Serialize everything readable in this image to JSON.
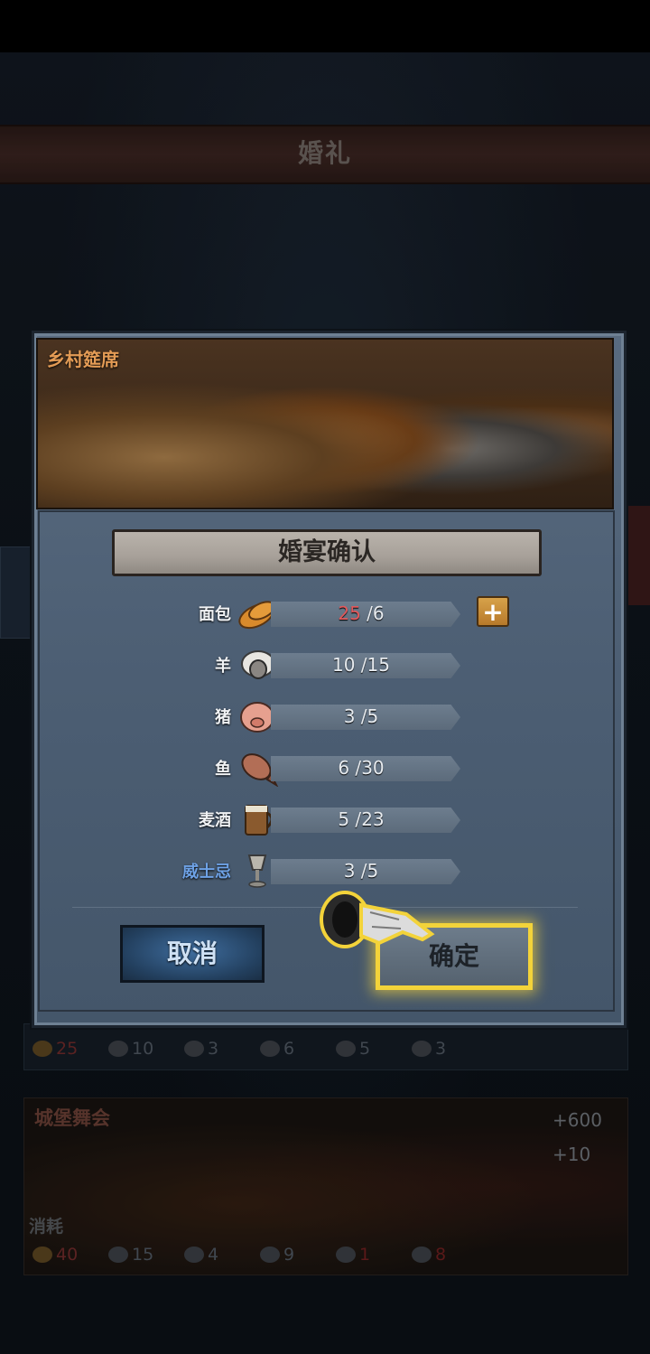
{
  "background": {
    "title": "婚礼",
    "strip_values": {
      "bread": "25",
      "sheep": "10",
      "pig": "3",
      "fish": "6",
      "ale": "5",
      "whiskey": "3"
    },
    "card2": {
      "title": "城堡舞会",
      "reward1": "+600",
      "reward2": "+10",
      "consume_label": "消耗",
      "values": {
        "bread": "40",
        "sheep": "15",
        "pig": "4",
        "fish": "9",
        "ale": "1",
        "whiskey": "8"
      }
    }
  },
  "modal": {
    "banner_title": "乡村筵席",
    "header": "婚宴确认",
    "rows": [
      {
        "label": "面包",
        "icon": "bread-icon",
        "current": "25",
        "required": "6"
      },
      {
        "label": "羊",
        "icon": "sheep-icon",
        "current": "10",
        "required": "15"
      },
      {
        "label": "猪",
        "icon": "pig-icon",
        "current": "3",
        "required": "5"
      },
      {
        "label": "鱼",
        "icon": "fish-icon",
        "current": "6",
        "required": "30"
      },
      {
        "label": "麦酒",
        "icon": "ale-icon",
        "current": "5",
        "required": "23"
      },
      {
        "label": "威士忌",
        "icon": "goblet-icon",
        "current": "3",
        "required": "5"
      }
    ],
    "cancel_label": "取消",
    "confirm_label": "确定"
  },
  "colors": {
    "accent_highlight": "#f3d33a",
    "shortage_red": "#e0595c",
    "banner_title": "#e39b55"
  }
}
